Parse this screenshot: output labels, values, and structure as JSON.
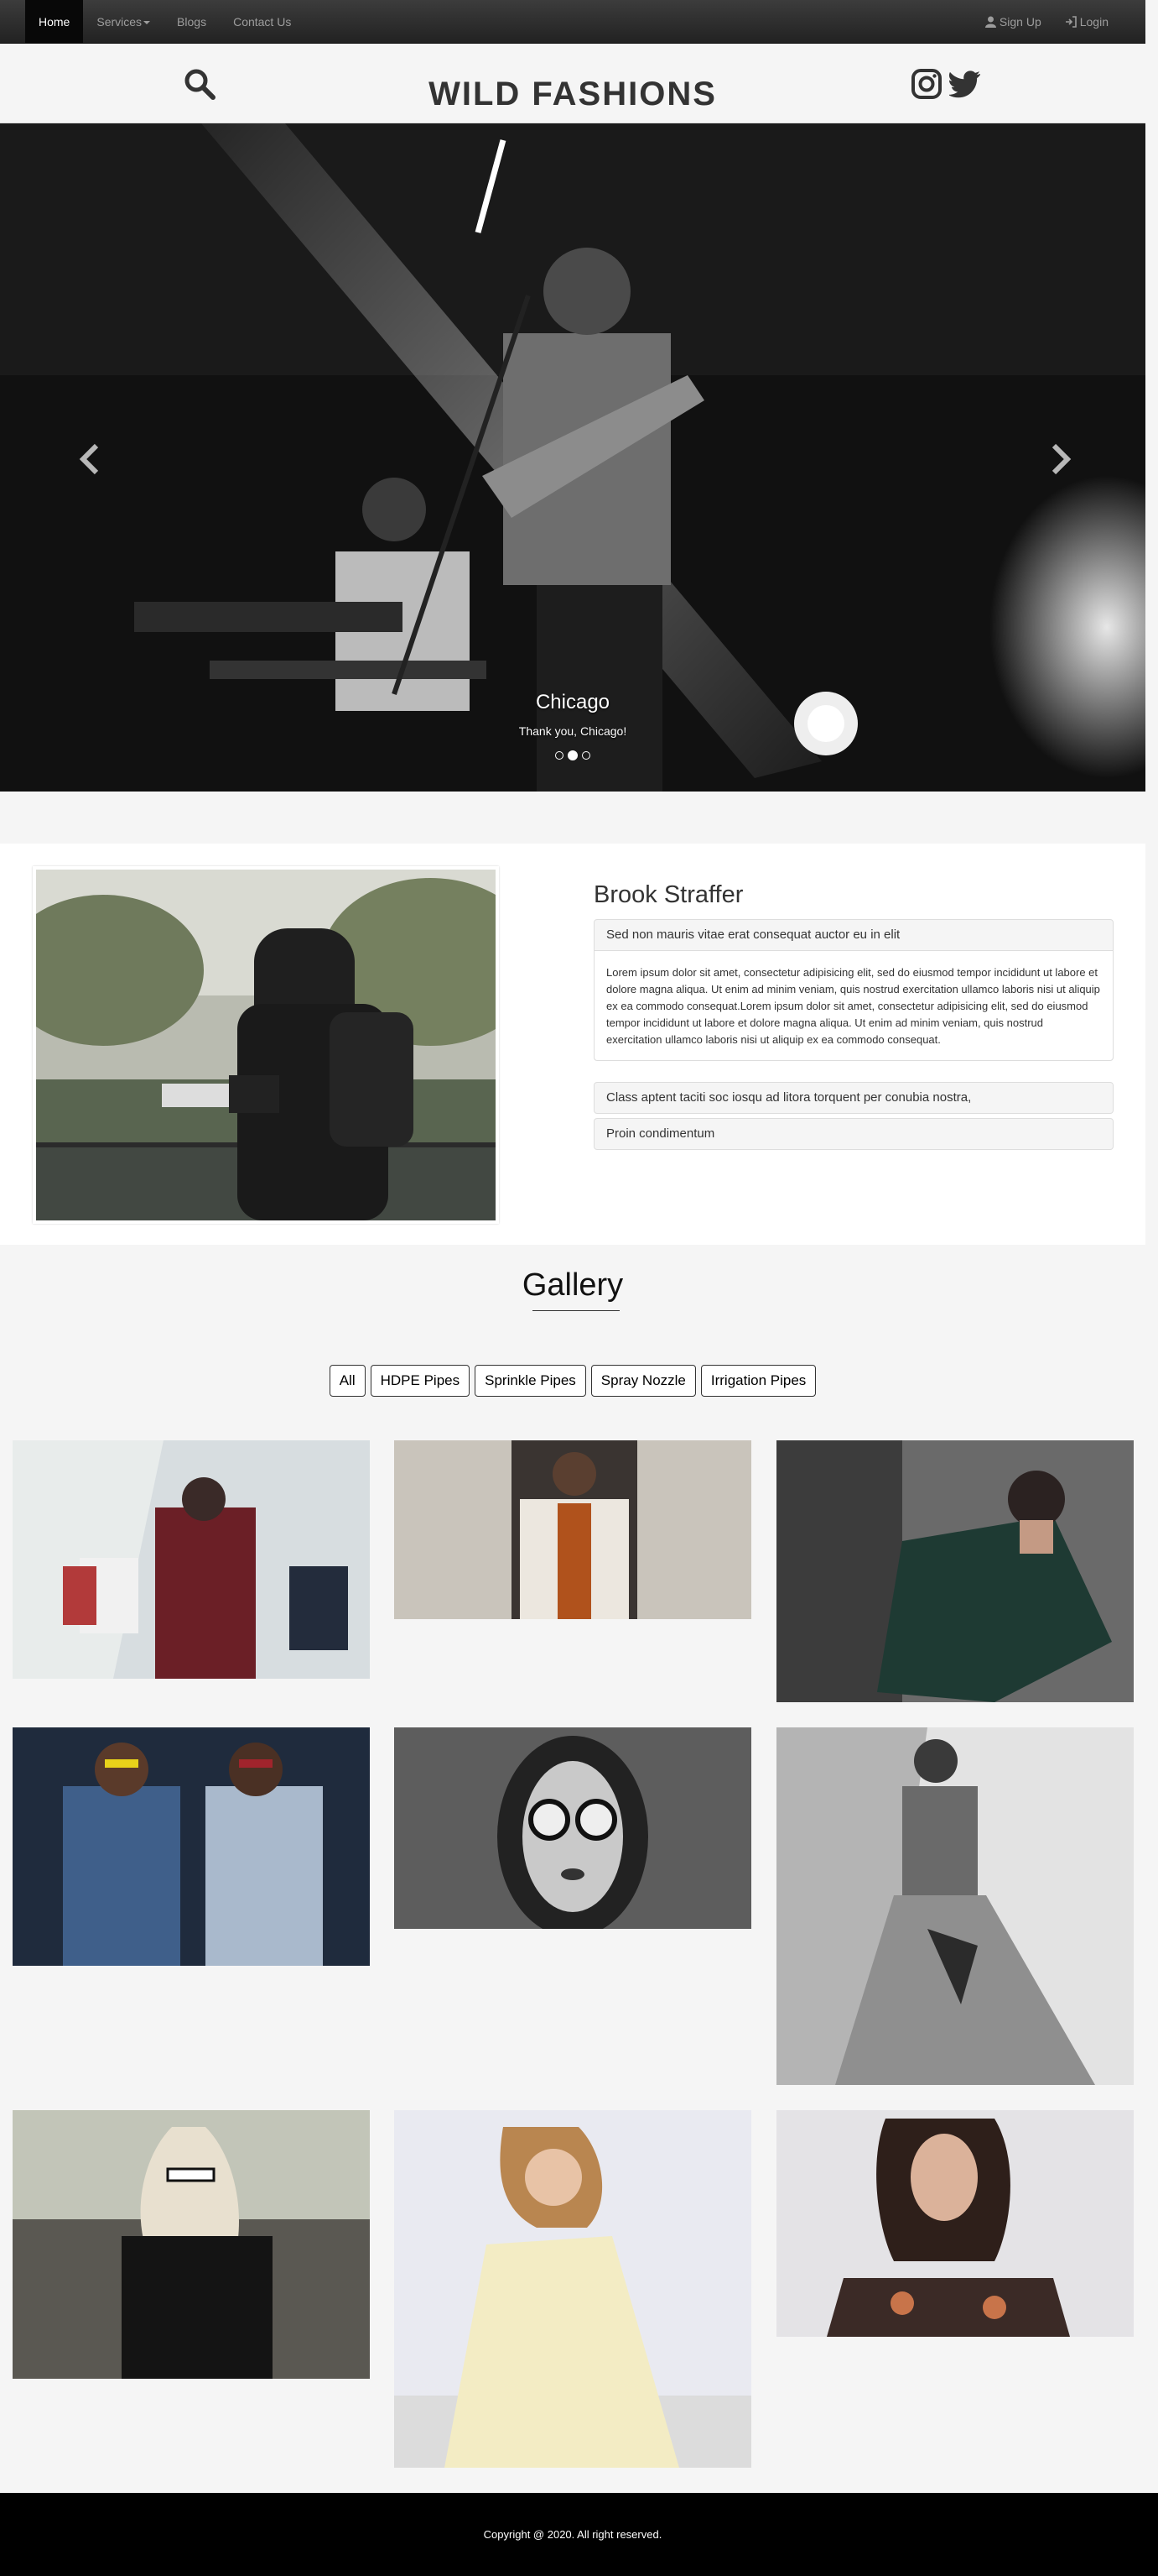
{
  "nav": {
    "items": [
      {
        "label": "Home"
      },
      {
        "label": "Services"
      },
      {
        "label": "Blogs"
      },
      {
        "label": "Contact Us"
      }
    ],
    "right": [
      {
        "label": "Sign Up",
        "icon": "user-icon"
      },
      {
        "label": "Login",
        "icon": "login-icon"
      }
    ]
  },
  "header": {
    "brand": "WILD FASHIONS"
  },
  "carousel": {
    "caption_title": "Chicago",
    "caption_text": "Thank you, Chicago!",
    "slide_count": 3,
    "active_slide": 2
  },
  "about": {
    "title": "Brook Straffer",
    "panels": [
      {
        "heading": "Sed non mauris vitae erat consequat auctor eu in elit",
        "body": "Lorem ipsum dolor sit amet, consectetur adipisicing elit, sed do eiusmod tempor incididunt ut labore et dolore magna aliqua. Ut enim ad minim veniam, quis nostrud exercitation ullamco laboris nisi ut aliquip ex ea commodo consequat.Lorem ipsum dolor sit amet, consectetur adipisicing elit, sed do eiusmod tempor incididunt ut labore et dolore magna aliqua. Ut enim ad minim veniam, quis nostrud exercitation ullamco laboris nisi ut aliquip ex ea commodo consequat."
      },
      {
        "heading": "Class aptent taciti soc iosqu ad litora torquent per conubia nostra,"
      },
      {
        "heading": "Proin condimentum"
      }
    ]
  },
  "gallery": {
    "title": "Gallery",
    "filters": [
      "All",
      "HDPE Pipes",
      "Sprinkle Pipes",
      "Spray Nozzle",
      "Irrigation Pipes"
    ]
  },
  "footer": {
    "text": "Copyright @ 2020. All right reserved."
  },
  "colors": {
    "navbar": "#222222",
    "footer": "#000000",
    "background": "#f5f5f5"
  }
}
